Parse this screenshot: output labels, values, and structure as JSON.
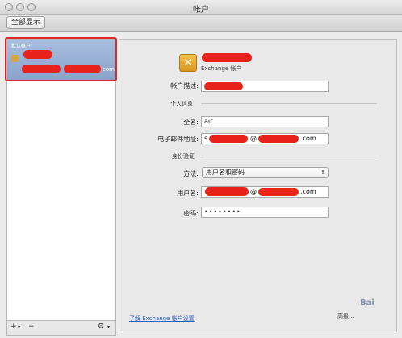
{
  "window": {
    "title": "帐户"
  },
  "toolbar": {
    "show_all": "全部显示"
  },
  "sidebar": {
    "selected_account": {
      "default_label": "默认帐户",
      "email_suffix": "com"
    },
    "footer": {
      "add": "+",
      "add_menu": "▾",
      "remove": "−",
      "gear": "⚙",
      "gear_menu": "▾"
    }
  },
  "account": {
    "type": "Exchange 帐户",
    "description_label": "帐户描述:",
    "personal_section": "个人信息",
    "full_name_label": "全名:",
    "full_name_value": "air",
    "email_label": "电子邮件地址:",
    "email_value_prefix": "s",
    "email_value_at": "@",
    "email_value_suffix": ".com",
    "auth_section": "身份验证",
    "method_label": "方法:",
    "method_value": "用户名和密码",
    "username_label": "用户名:",
    "username_value_at": "@",
    "username_value_suffix": ".com",
    "password_label": "密码:",
    "password_value": "••••••••"
  },
  "footer_links": {
    "learn": "了解 Exchange 帐户设置",
    "help": "高级..."
  },
  "watermark": "Bai"
}
